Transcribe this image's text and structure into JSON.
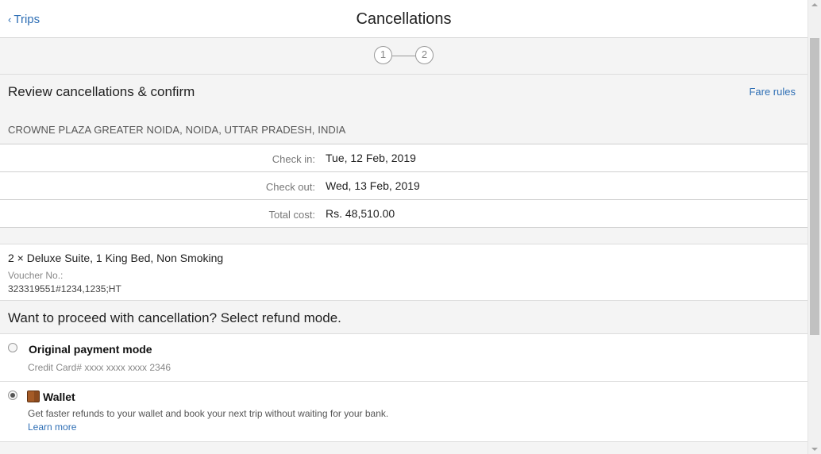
{
  "header": {
    "back_label": "Trips",
    "back_chevron": "‹",
    "title": "Cancellations"
  },
  "stepper": {
    "steps": [
      "1",
      "2"
    ],
    "current_step": 1
  },
  "review": {
    "title": "Review cancellations & confirm",
    "fare_rules_label": "Fare rules",
    "hotel_name": "CROWNE PLAZA GREATER NOIDA, NOIDA, UTTAR PRADESH, INDIA"
  },
  "details": [
    {
      "label": "Check in:",
      "value": "Tue, 12 Feb, 2019"
    },
    {
      "label": "Check out:",
      "value": "Wed, 13 Feb, 2019"
    },
    {
      "label": "Total cost:",
      "value": "Rs. 48,510.00"
    }
  ],
  "room": {
    "title": "2 × Deluxe Suite, 1 King Bed, Non Smoking",
    "voucher_label": "Voucher No.:",
    "voucher_value": "323319551#1234,1235;HT"
  },
  "refund": {
    "prompt": "Want to proceed with cancellation? Select refund mode.",
    "options": [
      {
        "title": "Original payment mode",
        "subtitle": "Credit Card# xxxx xxxx xxxx 2346",
        "selected": false
      },
      {
        "title": "Wallet",
        "icon": "wallet-icon",
        "description": "Get faster refunds to your wallet and book your next trip without waiting for your bank.",
        "link_label": "Learn more",
        "selected": true
      }
    ]
  },
  "colors": {
    "link": "#2f6fb5",
    "background": "#f4f4f4",
    "panel": "#ffffff",
    "wallet_brown": "#8b4a1e"
  }
}
